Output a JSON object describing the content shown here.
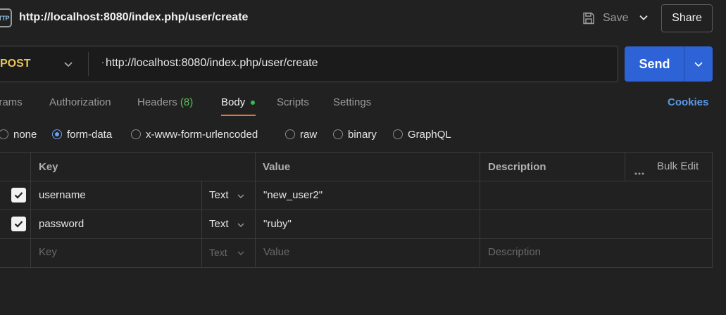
{
  "header": {
    "icon_text": "TTP",
    "title": "http://localhost:8080/index.php/user/create",
    "save_label": "Save",
    "share_label": "Share"
  },
  "request": {
    "method": "POST",
    "url": "http://localhost:8080/index.php/user/create",
    "send_label": "Send"
  },
  "tabs": [
    {
      "label": "arams"
    },
    {
      "label": "Authorization"
    },
    {
      "label": "Headers",
      "count": "(8)"
    },
    {
      "label": "Body",
      "active": true
    },
    {
      "label": "Scripts"
    },
    {
      "label": "Settings"
    }
  ],
  "cookies_label": "Cookies",
  "body_types": [
    {
      "label": "none",
      "checked": false
    },
    {
      "label": "form-data",
      "checked": true
    },
    {
      "label": "x-www-form-urlencoded",
      "checked": false
    },
    {
      "label": "raw",
      "checked": false
    },
    {
      "label": "binary",
      "checked": false
    },
    {
      "label": "GraphQL",
      "checked": false
    }
  ],
  "table": {
    "headers": {
      "key": "Key",
      "value": "Value",
      "description": "Description",
      "bulk_edit": "Bulk Edit"
    },
    "rows": [
      {
        "checked": true,
        "key": "username",
        "type": "Text",
        "value": "\"new_user2\"",
        "description": ""
      },
      {
        "checked": true,
        "key": "password",
        "type": "Text",
        "value": "\"ruby\"",
        "description": ""
      }
    ],
    "placeholder": {
      "key": "Key",
      "type": "Text",
      "value": "Value",
      "description": "Description"
    }
  },
  "colors": {
    "background": "#212121",
    "accent_blue": "#2d63d6",
    "method_post": "#e8c45a",
    "tab_underline": "#e0763a",
    "body_indicator": "#2fbf4a",
    "cookies_link": "#5b9ae8"
  }
}
